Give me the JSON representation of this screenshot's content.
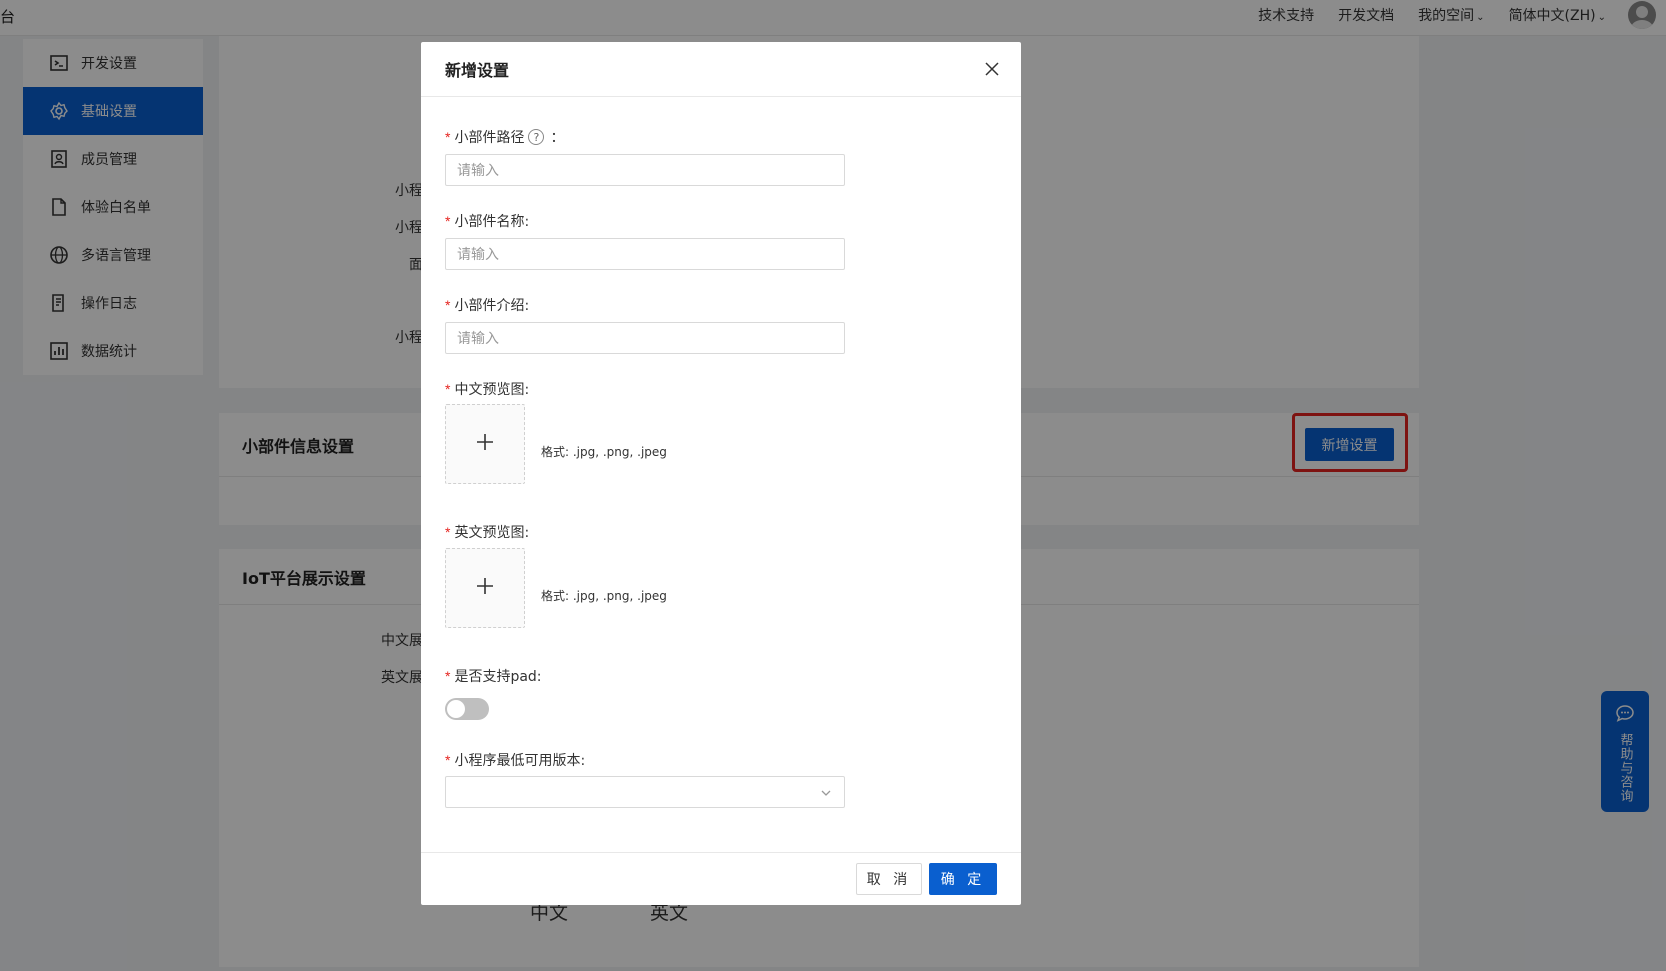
{
  "topbar": {
    "logo_fragment": "台",
    "nav": [
      "技术支持",
      "开发文档",
      "我的空间",
      "简体中文(ZH)"
    ]
  },
  "sidebar": {
    "items": [
      {
        "label": "开发设置",
        "icon": "terminal-icon",
        "active": false
      },
      {
        "label": "基础设置",
        "icon": "gear-icon",
        "active": true
      },
      {
        "label": "成员管理",
        "icon": "member-icon",
        "active": false
      },
      {
        "label": "体验白名单",
        "icon": "document-icon",
        "active": false
      },
      {
        "label": "多语言管理",
        "icon": "globe-icon",
        "active": false
      },
      {
        "label": "操作日志",
        "icon": "log-icon",
        "active": false
      },
      {
        "label": "数据统计",
        "icon": "chart-icon",
        "active": false
      }
    ]
  },
  "background": {
    "fragments": [
      "小程",
      "小程",
      "面",
      "小程",
      "中文展",
      "英文展",
      "中文",
      "英文"
    ],
    "widget_section_title": "小部件信息设置",
    "iot_section_title": "IoT平台展示设置",
    "add_button": "新增设置"
  },
  "help": {
    "label": "帮助与咨询"
  },
  "modal": {
    "title": "新增设置",
    "fields": {
      "path_label": "小部件路径",
      "path_colon": "：",
      "path_placeholder": "请输入",
      "name_label": "小部件名称:",
      "name_placeholder": "请输入",
      "intro_label": "小部件介绍:",
      "intro_placeholder": "请输入",
      "cn_preview_label": "中文预览图:",
      "cn_format": "格式: .jpg, .png, .jpeg",
      "en_preview_label": "英文预览图:",
      "en_format": "格式: .jpg, .png, .jpeg",
      "pad_label": "是否支持pad:",
      "pad_enabled": false,
      "min_version_label": "小程序最低可用版本:",
      "min_version_value": ""
    },
    "cancel": "取 消",
    "ok": "确 定"
  }
}
